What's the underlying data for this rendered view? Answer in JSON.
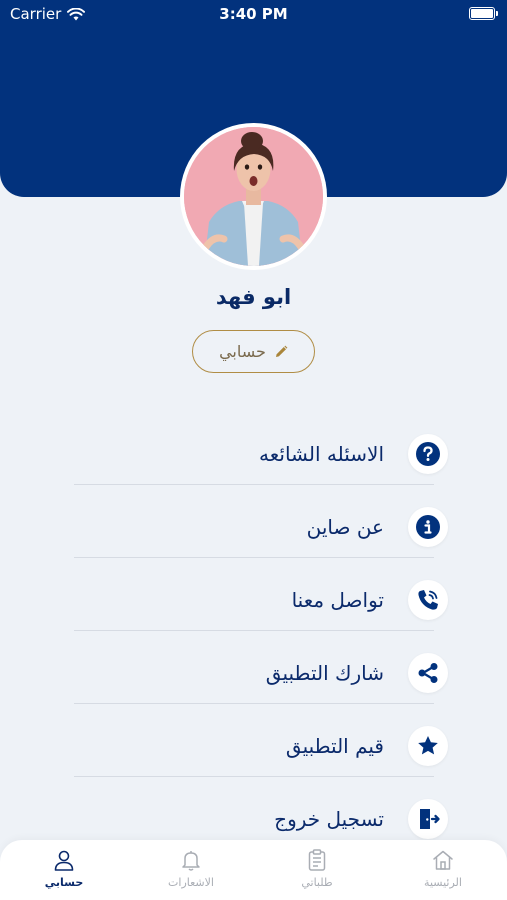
{
  "status_bar": {
    "carrier": "Carrier",
    "time": "3:40 PM"
  },
  "profile": {
    "name": "ابو فهد",
    "edit_label": "حسابي"
  },
  "menu": {
    "items": [
      {
        "label": "الاسئله الشائعه",
        "icon": "question-icon"
      },
      {
        "label": "عن صاين",
        "icon": "info-icon"
      },
      {
        "label": "تواصل معنا",
        "icon": "phone-icon"
      },
      {
        "label": "شارك التطبيق",
        "icon": "share-icon"
      },
      {
        "label": "قيم التطبيق",
        "icon": "star-icon"
      },
      {
        "label": "تسجيل خروج",
        "icon": "logout-icon"
      }
    ]
  },
  "tab_bar": {
    "tabs": [
      {
        "label": "حسابي",
        "icon": "person-icon",
        "active": true
      },
      {
        "label": "الاشعارات",
        "icon": "bell-icon",
        "active": false
      },
      {
        "label": "طلباتي",
        "icon": "clipboard-icon",
        "active": false
      },
      {
        "label": "الرئيسية",
        "icon": "home-icon",
        "active": false
      }
    ]
  },
  "colors": {
    "header": "#02327d",
    "background": "#eef2f7",
    "text": "#0b2a6b",
    "edit_border": "#b08d45",
    "tab_inactive": "#a9adb4"
  }
}
